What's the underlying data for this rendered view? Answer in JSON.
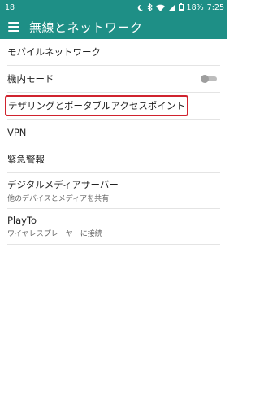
{
  "status": {
    "left_text": "18",
    "battery": "18%",
    "time": "7:25",
    "icons": [
      "moon-icon",
      "bluetooth-icon",
      "wifi-icon",
      "signal-icon",
      "battery-icon"
    ]
  },
  "header": {
    "title": "無線とネットワーク",
    "menu_icon": "hamburger-menu-icon"
  },
  "settings": {
    "items": [
      {
        "label": "モバイルネットワーク"
      },
      {
        "label": "機内モード",
        "toggle": "off"
      },
      {
        "label": "テザリングとポータブルアクセスポイント",
        "highlighted": true
      },
      {
        "label": "VPN"
      },
      {
        "label": "緊急警報"
      },
      {
        "label": "デジタルメディアサーバー",
        "sub": "他のデバイスとメディアを共有"
      },
      {
        "label": "PlayTo",
        "sub": "ワイヤレスプレーヤーに接続"
      }
    ]
  },
  "colors": {
    "accent": "#1e8f86",
    "highlight_border": "#d0232e"
  }
}
